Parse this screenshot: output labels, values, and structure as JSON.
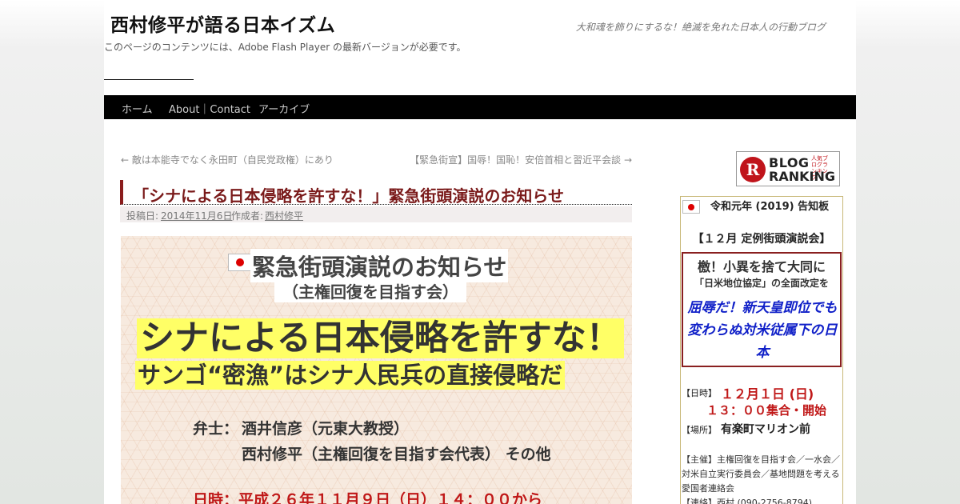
{
  "header": {
    "site_title": "西村修平が語る日本イズム",
    "site_description": "大和魂を飾りにするな！絶滅を免れた日本人の行動ブログ",
    "flash_note": "このページのコンテンツには、Adobe Flash Player の最新バージョンが必要です。"
  },
  "nav": {
    "items": [
      {
        "label": "ホーム"
      },
      {
        "label": "About｜Contact"
      },
      {
        "label": "アーカイブ"
      }
    ]
  },
  "post_nav": {
    "prev": "← 敵は本能寺でなく永田町（自民党政権）にあり",
    "next": "【緊急街宣】国辱！国恥！安倍首相と習近平会談 →"
  },
  "post": {
    "title": "「シナによる日本侵略を許すな！」緊急街頭演説のお知らせ",
    "meta_posted": "投稿日:",
    "meta_date": "2014年11月6日",
    "meta_author_label": "作成者:",
    "meta_author": "西村修平"
  },
  "flyer": {
    "heading": "緊急街頭演説のお知らせ",
    "sub": "（主権回復を目指す会）",
    "big1": "シナによる日本侵略を許すな！",
    "big2": "サンゴ“密漁”はシナ人民兵の直接侵略だ",
    "speaker_label": "弁士：",
    "speaker1": "酒井信彦（元東大教授）",
    "speaker2": "西村修平（主権回復を目指す会代表） その他",
    "date": "日時：平成２６年１１月９日（日）１４：００から"
  },
  "sidebar": {
    "ranking_top": "BLOG",
    "ranking_small": "人気ブログランキング",
    "ranking_bottom": "RANKING",
    "ranking_mark": "R",
    "notice_title": "令和元年 (2019) 告知板",
    "notice_head": "【１２月 定例街頭演説会】",
    "box_line1": "檄！小異を捨て大同に",
    "box_line2": "「日米地位協定」の全面改定を",
    "box_line3": "屈辱だ！新天皇即位でも変わらぬ対米従属下の日本",
    "date_label": "【日時】",
    "date_value": "１２月１日 (日)",
    "time_value": "１３：００集合・開始",
    "place_label": "【場所】",
    "place_value": "有楽町マリオン前",
    "organizers": "【主催】主権回復を目指す会／一水会／対米自立実行委員会／基地問題を考える愛国者連絡会",
    "contact": "【連絡】西村 (090-2756-8794)"
  },
  "colors": {
    "accent": "#8a1c1c",
    "nav_bg": "#000000",
    "highlight": "#ffff66",
    "alert_red": "#c01818",
    "notice_blue": "#1020c8"
  }
}
